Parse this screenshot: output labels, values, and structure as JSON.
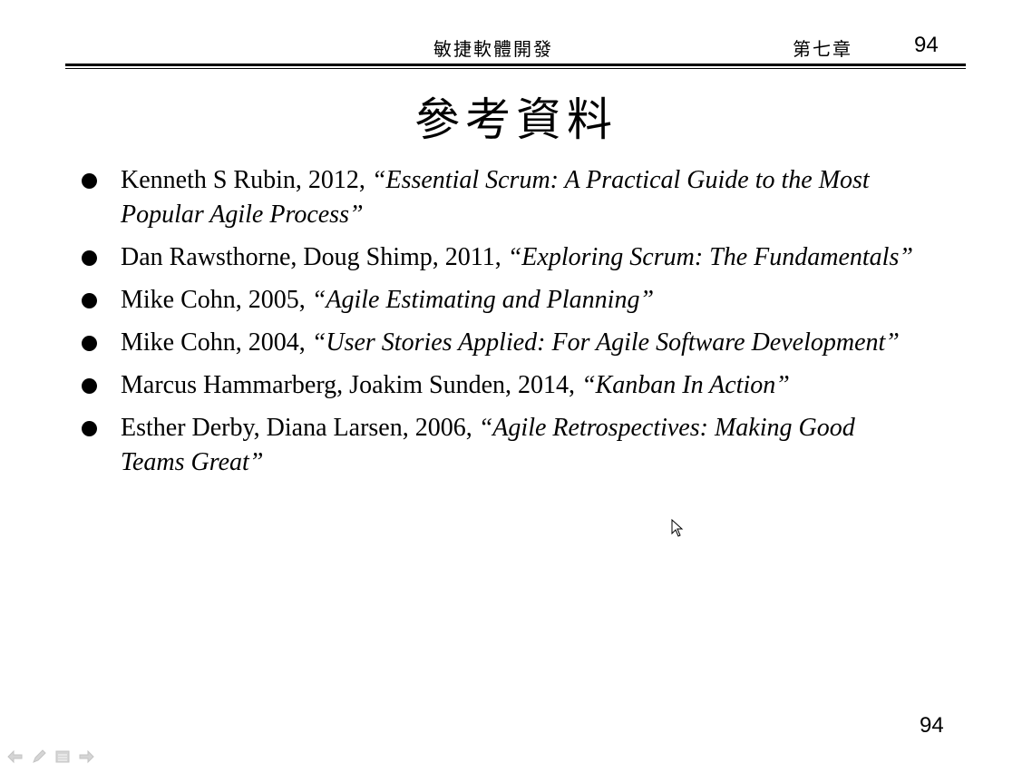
{
  "header": {
    "course_title": "敏捷軟體開發",
    "chapter": "第七章",
    "page_number": "94"
  },
  "slide": {
    "title": "參考資料",
    "references": [
      {
        "authors": "Kenneth S Rubin, 2012, ",
        "title": "“Essential Scrum: A Practical Guide to the Most Popular Agile Process”"
      },
      {
        "authors": "Dan Rawsthorne, Doug Shimp, 2011, ",
        "title": "“Exploring Scrum: The Fundamentals”"
      },
      {
        "authors": "Mike Cohn, 2005, ",
        "title": "“Agile Estimating and Planning”"
      },
      {
        "authors": "Mike Cohn, 2004, ",
        "title": "“User Stories Applied: For Agile Software Development”"
      },
      {
        "authors": "Marcus Hammarberg, Joakim Sunden, 2014, ",
        "title": "“Kanban In Action”"
      },
      {
        "authors": "Esther Derby, Diana Larsen, 2006, ",
        "title": "“Agile Retrospectives: Making Good Teams Great”"
      }
    ],
    "footer_page_number": "94"
  },
  "controls": {
    "icons": [
      "previous-arrow-icon",
      "pen-icon",
      "menu-icon",
      "next-arrow-icon"
    ]
  }
}
